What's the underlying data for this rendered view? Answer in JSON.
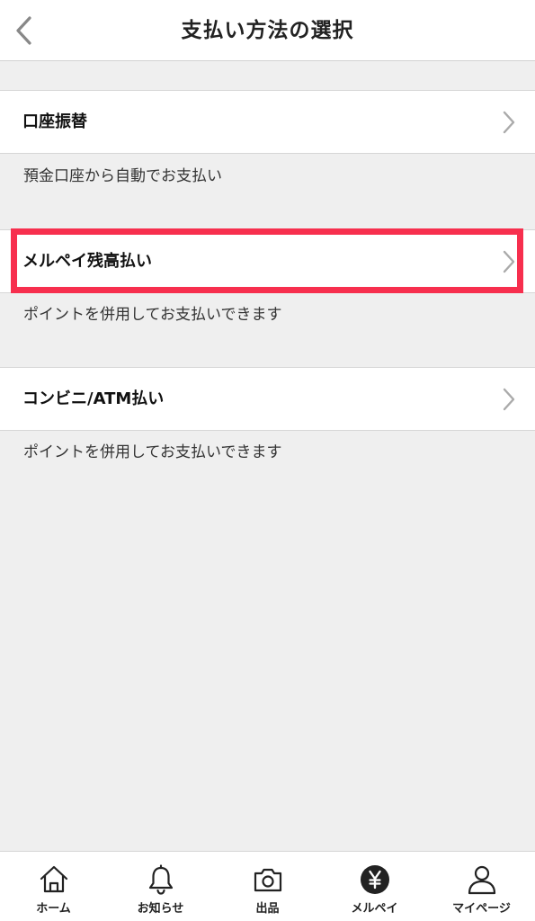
{
  "header": {
    "title": "支払い方法の選択"
  },
  "payment_methods": [
    {
      "label": "口座振替",
      "description": "預金口座から自動でお支払い"
    },
    {
      "label": "メルペイ残高払い",
      "description": "ポイントを併用してお支払いできます"
    },
    {
      "label": "コンビニ/ATM払い",
      "description": "ポイントを併用してお支払いできます"
    }
  ],
  "highlight": {
    "color": "#f72f4e"
  },
  "tabbar": {
    "items": [
      {
        "label": "ホーム",
        "icon": "home-icon"
      },
      {
        "label": "お知らせ",
        "icon": "bell-icon"
      },
      {
        "label": "出品",
        "icon": "camera-icon"
      },
      {
        "label": "メルペイ",
        "icon": "yen-icon"
      },
      {
        "label": "マイページ",
        "icon": "person-icon"
      }
    ]
  }
}
